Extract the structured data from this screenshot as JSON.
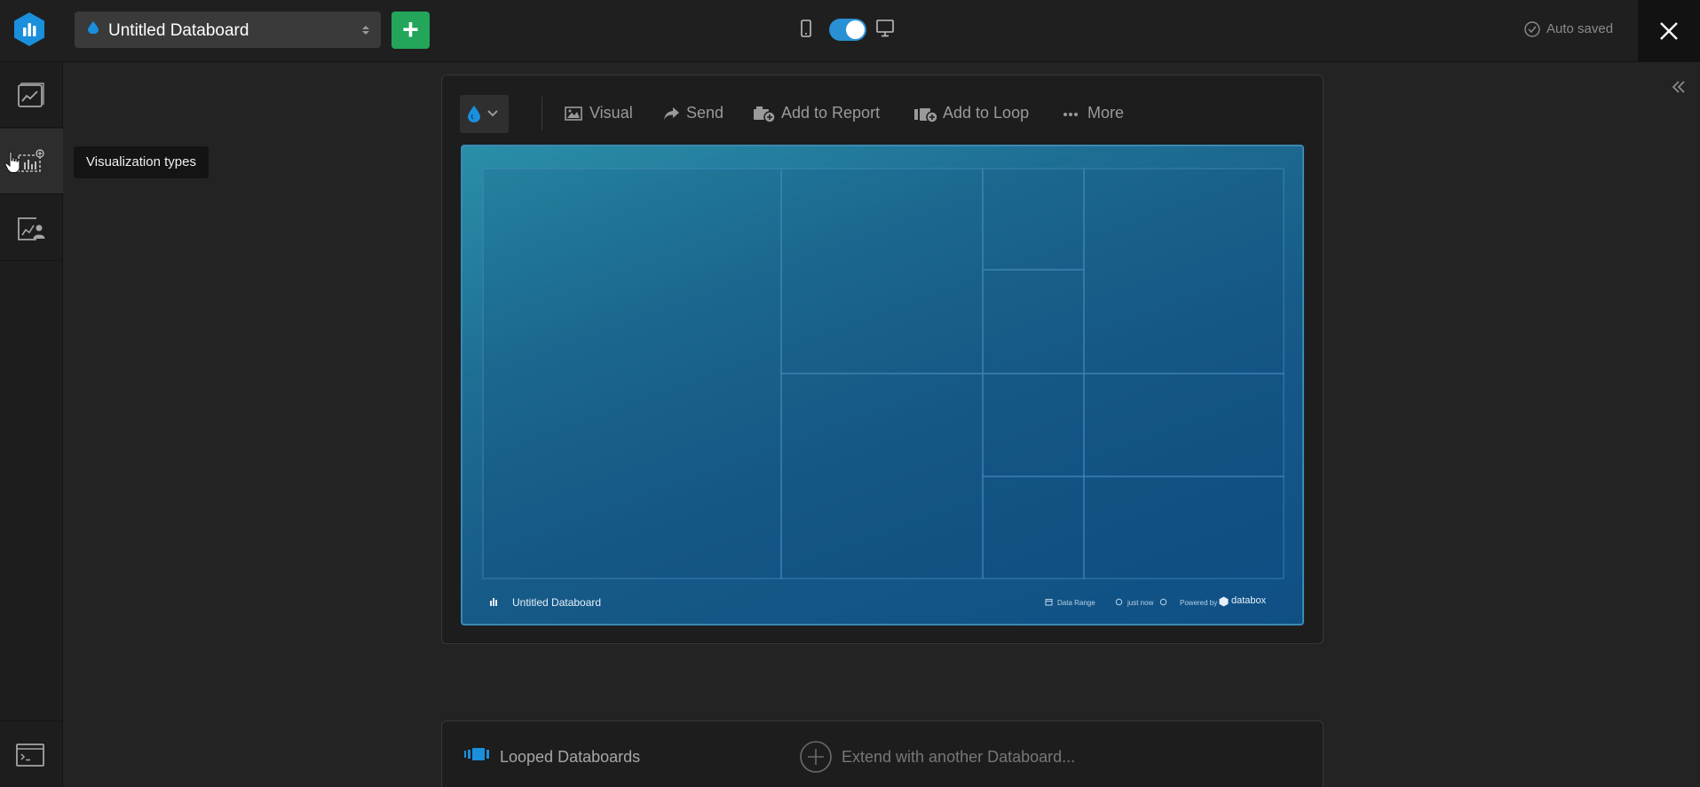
{
  "topbar": {
    "board_name": "Untitled Databoard",
    "add_label": "+",
    "autosave": "Auto saved"
  },
  "tooltip": "Visualization types",
  "toolbar": {
    "visual": "Visual",
    "send": "Send",
    "add_to_report": "Add to Report",
    "add_to_loop": "Add to Loop",
    "more": "More"
  },
  "preview": {
    "board_name": "Untitled Databoard",
    "date_range": "Data Range",
    "updated": "just now",
    "powered_by": "Powered by",
    "brand": "databox"
  },
  "looped": {
    "title": "Looped Databoards",
    "extend": "Extend with another Databoard..."
  },
  "colors": {
    "accent": "#2a90d6",
    "add_button": "#23a65a",
    "background": "#232323"
  }
}
